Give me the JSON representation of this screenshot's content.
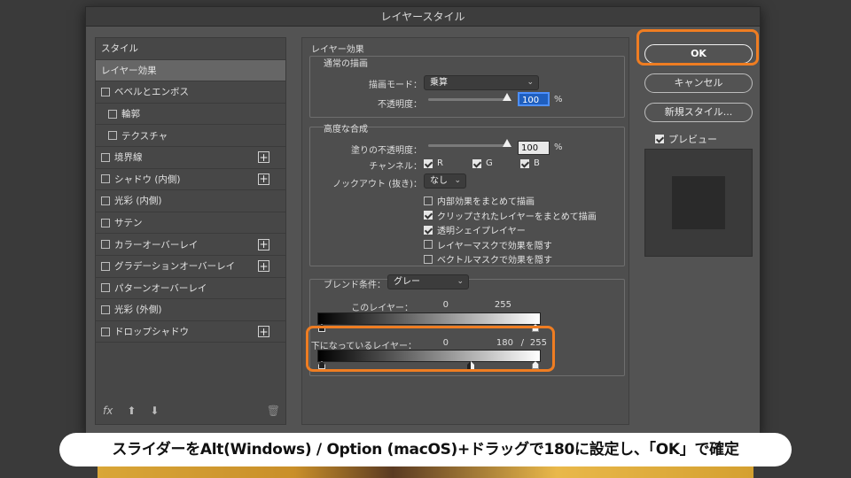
{
  "window": {
    "title": "レイヤースタイル"
  },
  "sidebar": {
    "items": [
      {
        "label": "スタイル",
        "checkbox": false,
        "plus": false,
        "selected": false
      },
      {
        "label": "レイヤー効果",
        "checkbox": false,
        "plus": false,
        "selected": true
      },
      {
        "label": "ベベルとエンボス",
        "checkbox": true,
        "plus": false
      },
      {
        "label": "輪郭",
        "checkbox": true,
        "plus": false,
        "sub": true
      },
      {
        "label": "テクスチャ",
        "checkbox": true,
        "plus": false,
        "sub": true
      },
      {
        "label": "境界線",
        "checkbox": true,
        "plus": true
      },
      {
        "label": "シャドウ (内側)",
        "checkbox": true,
        "plus": true
      },
      {
        "label": "光彩 (内側)",
        "checkbox": true,
        "plus": false
      },
      {
        "label": "サテン",
        "checkbox": true,
        "plus": false
      },
      {
        "label": "カラーオーバーレイ",
        "checkbox": true,
        "plus": true
      },
      {
        "label": "グラデーションオーバーレイ",
        "checkbox": true,
        "plus": true
      },
      {
        "label": "パターンオーバーレイ",
        "checkbox": true,
        "plus": false
      },
      {
        "label": "光彩 (外側)",
        "checkbox": true,
        "plus": false
      },
      {
        "label": "ドロップシャドウ",
        "checkbox": true,
        "plus": true
      }
    ],
    "footer": {
      "fx": "fx",
      "up": "⬆",
      "down": "⬇",
      "trash": "🗑"
    }
  },
  "layer_effects": {
    "title": "レイヤー効果",
    "normal": {
      "title": "通常の描画",
      "blend_mode_label": "描画モード：",
      "blend_mode_value": "乗算",
      "opacity_label": "不透明度：",
      "opacity_value": "100",
      "opacity_unit": "%"
    },
    "advanced": {
      "title": "高度な合成",
      "fill_opacity_label": "塗りの不透明度：",
      "fill_opacity_value": "100",
      "fill_opacity_unit": "%",
      "channels_label": "チャンネル：",
      "channel_r": "R",
      "channel_g": "G",
      "channel_b": "B",
      "knockout_label": "ノックアウト (抜き)：",
      "knockout_value": "なし",
      "options": [
        {
          "label": "内部効果をまとめて描画",
          "checked": false
        },
        {
          "label": "クリップされたレイヤーをまとめて描画",
          "checked": true
        },
        {
          "label": "透明シェイプレイヤー",
          "checked": true
        },
        {
          "label": "レイヤーマスクで効果を隠す",
          "checked": false
        },
        {
          "label": "ベクトルマスクで効果を隠す",
          "checked": false
        }
      ]
    },
    "blend_if": {
      "label": "ブレンド条件：",
      "value": "グレー",
      "this_layer_label": "このレイヤー：",
      "this_layer_low": "0",
      "this_layer_high": "255",
      "underlying_label": "下になっているレイヤー：",
      "underlying_low": "0",
      "underlying_high_split": "180",
      "underlying_sep": "/",
      "underlying_high": "255"
    }
  },
  "buttons": {
    "ok": "OK",
    "cancel": "キャンセル",
    "new_style": "新規スタイル...",
    "preview_label": "プレビュー"
  },
  "caption": "スライダーをAlt(Windows) / Option (macOS)+ドラッグで180に設定し、「OK」で確定",
  "colors": {
    "highlight": "#ef7d22",
    "focus": "#1f5fbf"
  }
}
